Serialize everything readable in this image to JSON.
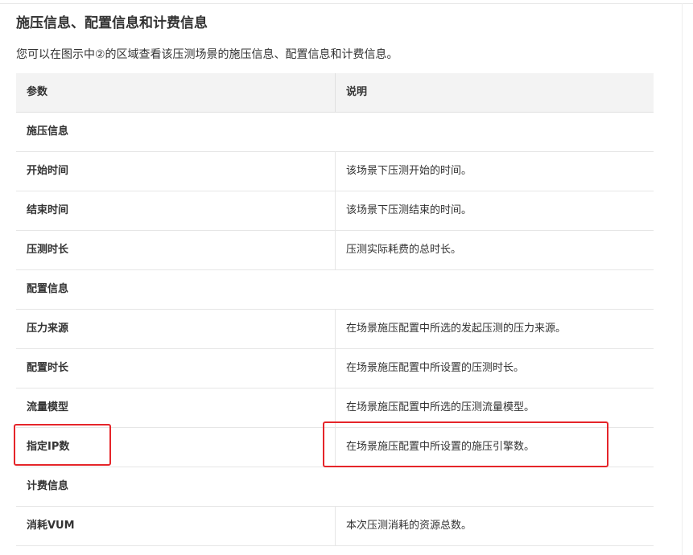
{
  "section": {
    "title": "施压信息、配置信息和计费信息",
    "intro": "您可以在图示中②的区域查看该压测场景的施压信息、配置信息和计费信息。"
  },
  "table": {
    "headers": [
      "参数",
      "说明"
    ],
    "rows": [
      {
        "type": "group",
        "param": "施压信息"
      },
      {
        "type": "item",
        "param": "开始时间",
        "desc": "该场景下压测开始的时间。"
      },
      {
        "type": "item",
        "param": "结束时间",
        "desc": "该场景下压测结束的时间。"
      },
      {
        "type": "item",
        "param": "压测时长",
        "desc": "压测实际耗费的总时长。"
      },
      {
        "type": "group",
        "param": "配置信息"
      },
      {
        "type": "item",
        "param": "压力来源",
        "desc": "在场景施压配置中所选的发起压测的压力来源。"
      },
      {
        "type": "item",
        "param": "配置时长",
        "desc": "在场景施压配置中所设置的压测时长。"
      },
      {
        "type": "item",
        "param": "流量模型",
        "desc": "在场景施压配置中所选的压测流量模型。"
      },
      {
        "type": "item",
        "param": "指定IP数",
        "desc": "在场景施压配置中所设置的施压引擎数。"
      },
      {
        "type": "group",
        "param": "计费信息"
      },
      {
        "type": "item",
        "param": "消耗VUM",
        "desc": "本次压测消耗的资源总数。"
      }
    ]
  },
  "colors": {
    "highlight": "#e5252a",
    "header_bg": "#f3f3f3",
    "border": "#e6e6e6"
  }
}
